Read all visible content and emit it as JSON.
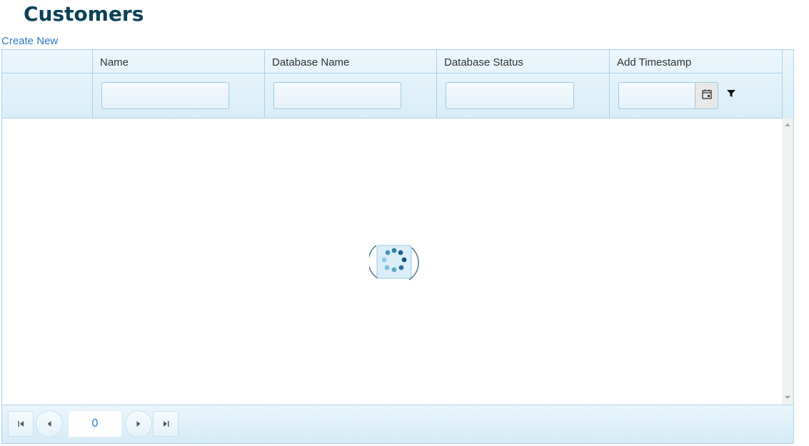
{
  "page": {
    "title": "Customers",
    "create_new_label": "Create New"
  },
  "grid": {
    "columns": [
      {
        "label": ""
      },
      {
        "label": "Name"
      },
      {
        "label": "Database Name"
      },
      {
        "label": "Database Status"
      },
      {
        "label": "Add Timestamp"
      }
    ],
    "filters": {
      "name": {
        "value": "",
        "placeholder": ""
      },
      "database_name": {
        "value": "",
        "placeholder": ""
      },
      "database_status": {
        "value": "",
        "placeholder": ""
      },
      "add_timestamp": {
        "value": "",
        "placeholder": ""
      }
    },
    "rows": [],
    "loading": true
  },
  "pager": {
    "current_page": "0"
  },
  "icons": {
    "first": "first-page-icon",
    "prev": "prev-page-icon",
    "next": "next-page-icon",
    "last": "last-page-icon",
    "calendar": "calendar-icon",
    "filter": "filter-icon",
    "loading": "loading-spinner-icon"
  },
  "colors": {
    "title": "#0b4257",
    "link": "#2b7bc0",
    "grid_border": "#a9d2e6",
    "header_bg": "#d9edf7"
  }
}
